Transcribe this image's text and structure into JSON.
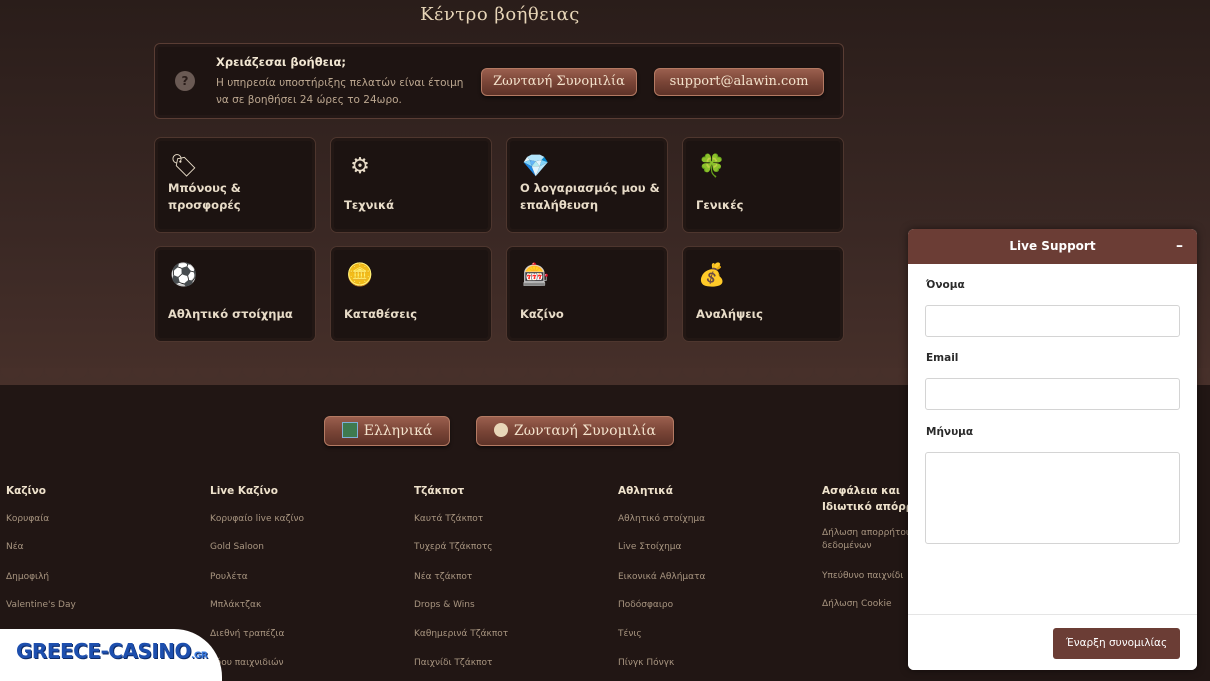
{
  "help": {
    "title": "Κέντρο βοήθειας",
    "heading": "Χρειάζεσαι βοήθεια;",
    "text": "Η υπηρεσία υποστήριξης πελατών είναι έτοιμη να σε βοηθήσει 24 ώρες το 24ωρο.",
    "live_chat_label": "Ζωντανή Συνομιλία",
    "email_label": "support@alawin.com"
  },
  "categories": [
    {
      "label": "Μπόνους & προσφορές",
      "icon": "bonus-tag-icon",
      "glyph": "🏷"
    },
    {
      "label": "Τεχνικά",
      "icon": "gear-icon",
      "glyph": "⚙"
    },
    {
      "label": "Ο λογαριασμός μου & επαλήθευση",
      "icon": "account-gem-icon",
      "glyph": "💎"
    },
    {
      "label": "Γενικές",
      "icon": "clover-icon",
      "glyph": "🍀"
    },
    {
      "label": "Αθλητικό στοίχημα",
      "icon": "ball-icon",
      "glyph": "⚽"
    },
    {
      "label": "Καταθέσεις",
      "icon": "deposit-coins-icon",
      "glyph": "🪙"
    },
    {
      "label": "Καζίνο",
      "icon": "casino-chip-icon",
      "glyph": "🎰"
    },
    {
      "label": "Αναλήψεις",
      "icon": "withdraw-coins-icon",
      "glyph": "💰"
    }
  ],
  "buttons": {
    "language_label": "Ελληνικά",
    "live_chat_label": "Ζωντανή Συνομιλία"
  },
  "footer": {
    "columns": [
      {
        "title": "Καζίνο",
        "links": [
          "Κορυφαία",
          "Νέα",
          "Δημοφιλή",
          "Valentine's Day"
        ]
      },
      {
        "title": "Live Καζίνο",
        "links": [
          "Κορυφαίο live καζίνο",
          "Gold Saloon",
          "Ρουλέτα",
          "Μπλάκτζακ",
          "Διεθνή τραπέζια",
          "Σόου παιχνιδιών"
        ]
      },
      {
        "title": "Τζάκποτ",
        "links": [
          "Καυτά Τζάκποτ",
          "Τυχερά Τζάκποτς",
          "Νέα τζάκποτ",
          "Drops & Wins",
          "Καθημερινά Τζάκποτ",
          "Παιχνίδι Τζάκποτ"
        ]
      },
      {
        "title": "Αθλητικά",
        "links": [
          "Αθλητικό στοίχημα",
          "Live Στοίχημα",
          "Εικονικά Αθλήματα",
          "Ποδόσφαιρο",
          "Τένις",
          "Πίνγκ Πόνγκ"
        ]
      },
      {
        "title": "Ασφάλεια και Ιδιωτικό απόρρητο",
        "links": [
          "Δήλωση απορρήτου δεδομένων",
          "Υπεύθυνο παιχνίδι",
          "Δήλωση Cookie"
        ]
      }
    ]
  },
  "logo": {
    "text": "GREECE-CASINO",
    "suffix": ".GR"
  },
  "chat": {
    "title": "Live Support",
    "minimize": "–",
    "name_label": "Όνομα",
    "email_label": "Email",
    "message_label": "Μήνυμα",
    "submit_label": "Έναρξη συνομιλίας"
  },
  "colors": {
    "background_dark": "#231715",
    "accent_brown": "#6b3d35",
    "button_copper": "#7a4537"
  }
}
